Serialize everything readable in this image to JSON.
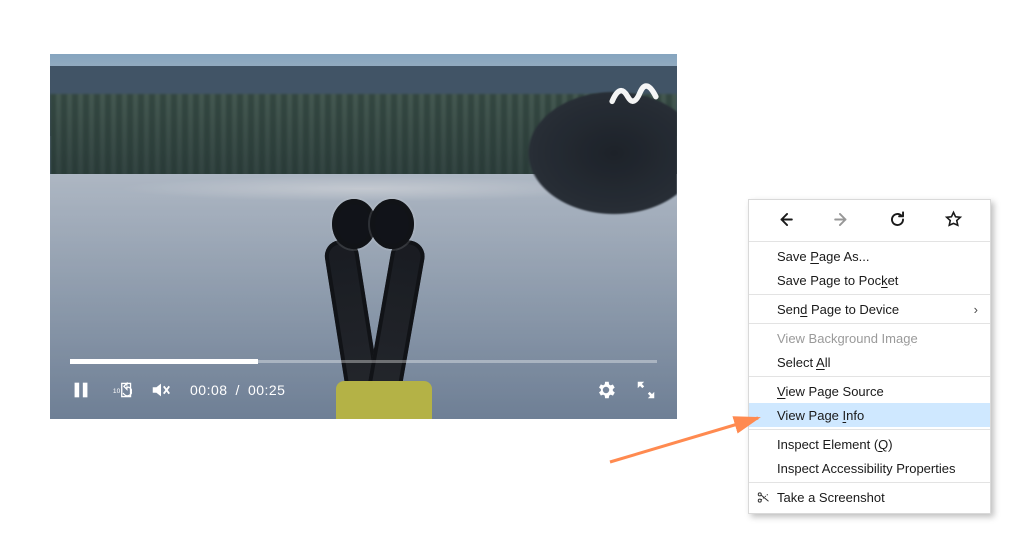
{
  "player": {
    "current_time": "00:08",
    "total_time": "00:25",
    "time_separator": "/",
    "progress_percent": 32,
    "watermark": "wave-logo",
    "controls": {
      "pause": "pause",
      "replay10": "replay-10",
      "mute": "muted",
      "settings": "settings",
      "fullscreen": "fullscreen"
    }
  },
  "context_menu": {
    "nav": {
      "back": "back",
      "forward": "forward",
      "reload": "reload",
      "bookmark": "bookmark"
    },
    "items": [
      {
        "label_before": "Save ",
        "accel": "P",
        "label_after": "age As...",
        "kind": "item"
      },
      {
        "label_before": "Save Page to Poc",
        "accel": "k",
        "label_after": "et",
        "kind": "item"
      },
      {
        "kind": "sep"
      },
      {
        "label_before": "Sen",
        "accel": "d",
        "label_after": " Page to Device",
        "kind": "submenu"
      },
      {
        "kind": "sep"
      },
      {
        "label_before": "View Background Ima",
        "accel": "g",
        "label_after": "e",
        "kind": "disabled"
      },
      {
        "label_before": "Select ",
        "accel": "A",
        "label_after": "ll",
        "kind": "item"
      },
      {
        "kind": "sep"
      },
      {
        "label_before": "",
        "accel": "V",
        "label_after": "iew Page Source",
        "kind": "item"
      },
      {
        "label_before": "View Page ",
        "accel": "I",
        "label_after": "nfo",
        "kind": "highlight"
      },
      {
        "kind": "sep"
      },
      {
        "label_before": "Inspect Element (",
        "accel": "Q",
        "label_after": ")",
        "kind": "item"
      },
      {
        "label_before": "Inspect Accessibility Properties",
        "accel": "",
        "label_after": "",
        "kind": "item"
      },
      {
        "kind": "sep"
      },
      {
        "label_before": "Take a Screenshot",
        "accel": "",
        "label_after": "",
        "kind": "item",
        "leading_icon": "scissors"
      }
    ],
    "submenu_glyph": "›"
  },
  "annotation": {
    "arrow": "points-to-view-page-info"
  }
}
